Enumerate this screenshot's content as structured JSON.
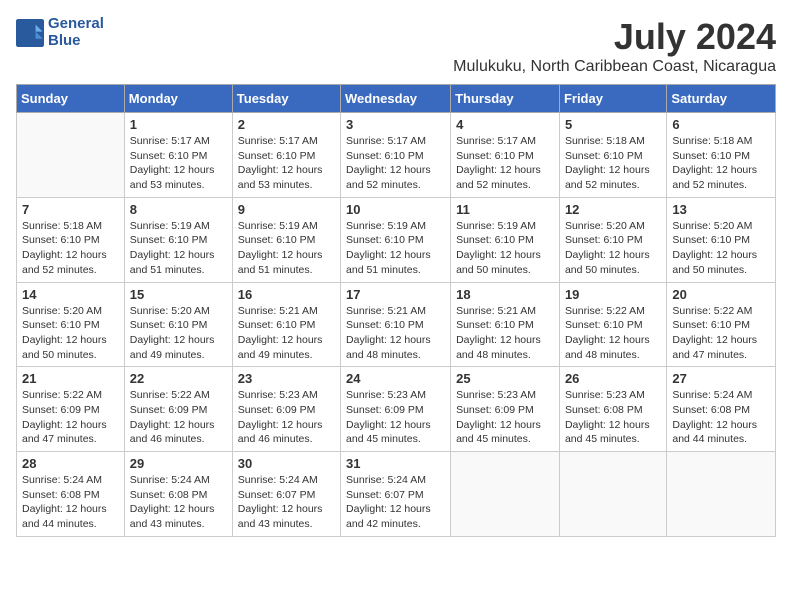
{
  "header": {
    "logo_line1": "General",
    "logo_line2": "Blue",
    "title": "July 2024",
    "subtitle": "Mulukuku, North Caribbean Coast, Nicaragua"
  },
  "weekdays": [
    "Sunday",
    "Monday",
    "Tuesday",
    "Wednesday",
    "Thursday",
    "Friday",
    "Saturday"
  ],
  "weeks": [
    [
      {
        "day": "",
        "sunrise": "",
        "sunset": "",
        "daylight": ""
      },
      {
        "day": "1",
        "sunrise": "Sunrise: 5:17 AM",
        "sunset": "Sunset: 6:10 PM",
        "daylight": "Daylight: 12 hours and 53 minutes."
      },
      {
        "day": "2",
        "sunrise": "Sunrise: 5:17 AM",
        "sunset": "Sunset: 6:10 PM",
        "daylight": "Daylight: 12 hours and 53 minutes."
      },
      {
        "day": "3",
        "sunrise": "Sunrise: 5:17 AM",
        "sunset": "Sunset: 6:10 PM",
        "daylight": "Daylight: 12 hours and 52 minutes."
      },
      {
        "day": "4",
        "sunrise": "Sunrise: 5:17 AM",
        "sunset": "Sunset: 6:10 PM",
        "daylight": "Daylight: 12 hours and 52 minutes."
      },
      {
        "day": "5",
        "sunrise": "Sunrise: 5:18 AM",
        "sunset": "Sunset: 6:10 PM",
        "daylight": "Daylight: 12 hours and 52 minutes."
      },
      {
        "day": "6",
        "sunrise": "Sunrise: 5:18 AM",
        "sunset": "Sunset: 6:10 PM",
        "daylight": "Daylight: 12 hours and 52 minutes."
      }
    ],
    [
      {
        "day": "7",
        "sunrise": "Sunrise: 5:18 AM",
        "sunset": "Sunset: 6:10 PM",
        "daylight": "Daylight: 12 hours and 52 minutes."
      },
      {
        "day": "8",
        "sunrise": "Sunrise: 5:19 AM",
        "sunset": "Sunset: 6:10 PM",
        "daylight": "Daylight: 12 hours and 51 minutes."
      },
      {
        "day": "9",
        "sunrise": "Sunrise: 5:19 AM",
        "sunset": "Sunset: 6:10 PM",
        "daylight": "Daylight: 12 hours and 51 minutes."
      },
      {
        "day": "10",
        "sunrise": "Sunrise: 5:19 AM",
        "sunset": "Sunset: 6:10 PM",
        "daylight": "Daylight: 12 hours and 51 minutes."
      },
      {
        "day": "11",
        "sunrise": "Sunrise: 5:19 AM",
        "sunset": "Sunset: 6:10 PM",
        "daylight": "Daylight: 12 hours and 50 minutes."
      },
      {
        "day": "12",
        "sunrise": "Sunrise: 5:20 AM",
        "sunset": "Sunset: 6:10 PM",
        "daylight": "Daylight: 12 hours and 50 minutes."
      },
      {
        "day": "13",
        "sunrise": "Sunrise: 5:20 AM",
        "sunset": "Sunset: 6:10 PM",
        "daylight": "Daylight: 12 hours and 50 minutes."
      }
    ],
    [
      {
        "day": "14",
        "sunrise": "Sunrise: 5:20 AM",
        "sunset": "Sunset: 6:10 PM",
        "daylight": "Daylight: 12 hours and 50 minutes."
      },
      {
        "day": "15",
        "sunrise": "Sunrise: 5:20 AM",
        "sunset": "Sunset: 6:10 PM",
        "daylight": "Daylight: 12 hours and 49 minutes."
      },
      {
        "day": "16",
        "sunrise": "Sunrise: 5:21 AM",
        "sunset": "Sunset: 6:10 PM",
        "daylight": "Daylight: 12 hours and 49 minutes."
      },
      {
        "day": "17",
        "sunrise": "Sunrise: 5:21 AM",
        "sunset": "Sunset: 6:10 PM",
        "daylight": "Daylight: 12 hours and 48 minutes."
      },
      {
        "day": "18",
        "sunrise": "Sunrise: 5:21 AM",
        "sunset": "Sunset: 6:10 PM",
        "daylight": "Daylight: 12 hours and 48 minutes."
      },
      {
        "day": "19",
        "sunrise": "Sunrise: 5:22 AM",
        "sunset": "Sunset: 6:10 PM",
        "daylight": "Daylight: 12 hours and 48 minutes."
      },
      {
        "day": "20",
        "sunrise": "Sunrise: 5:22 AM",
        "sunset": "Sunset: 6:10 PM",
        "daylight": "Daylight: 12 hours and 47 minutes."
      }
    ],
    [
      {
        "day": "21",
        "sunrise": "Sunrise: 5:22 AM",
        "sunset": "Sunset: 6:09 PM",
        "daylight": "Daylight: 12 hours and 47 minutes."
      },
      {
        "day": "22",
        "sunrise": "Sunrise: 5:22 AM",
        "sunset": "Sunset: 6:09 PM",
        "daylight": "Daylight: 12 hours and 46 minutes."
      },
      {
        "day": "23",
        "sunrise": "Sunrise: 5:23 AM",
        "sunset": "Sunset: 6:09 PM",
        "daylight": "Daylight: 12 hours and 46 minutes."
      },
      {
        "day": "24",
        "sunrise": "Sunrise: 5:23 AM",
        "sunset": "Sunset: 6:09 PM",
        "daylight": "Daylight: 12 hours and 45 minutes."
      },
      {
        "day": "25",
        "sunrise": "Sunrise: 5:23 AM",
        "sunset": "Sunset: 6:09 PM",
        "daylight": "Daylight: 12 hours and 45 minutes."
      },
      {
        "day": "26",
        "sunrise": "Sunrise: 5:23 AM",
        "sunset": "Sunset: 6:08 PM",
        "daylight": "Daylight: 12 hours and 45 minutes."
      },
      {
        "day": "27",
        "sunrise": "Sunrise: 5:24 AM",
        "sunset": "Sunset: 6:08 PM",
        "daylight": "Daylight: 12 hours and 44 minutes."
      }
    ],
    [
      {
        "day": "28",
        "sunrise": "Sunrise: 5:24 AM",
        "sunset": "Sunset: 6:08 PM",
        "daylight": "Daylight: 12 hours and 44 minutes."
      },
      {
        "day": "29",
        "sunrise": "Sunrise: 5:24 AM",
        "sunset": "Sunset: 6:08 PM",
        "daylight": "Daylight: 12 hours and 43 minutes."
      },
      {
        "day": "30",
        "sunrise": "Sunrise: 5:24 AM",
        "sunset": "Sunset: 6:07 PM",
        "daylight": "Daylight: 12 hours and 43 minutes."
      },
      {
        "day": "31",
        "sunrise": "Sunrise: 5:24 AM",
        "sunset": "Sunset: 6:07 PM",
        "daylight": "Daylight: 12 hours and 42 minutes."
      },
      {
        "day": "",
        "sunrise": "",
        "sunset": "",
        "daylight": ""
      },
      {
        "day": "",
        "sunrise": "",
        "sunset": "",
        "daylight": ""
      },
      {
        "day": "",
        "sunrise": "",
        "sunset": "",
        "daylight": ""
      }
    ]
  ]
}
